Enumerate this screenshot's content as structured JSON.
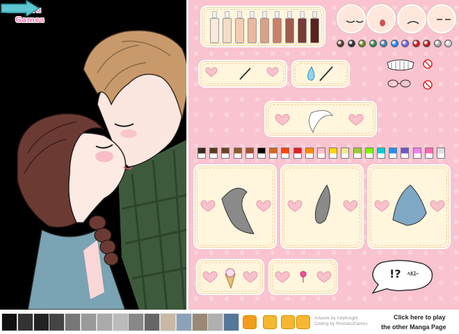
{
  "logo": {
    "line1": "Rinmaru",
    "line2": "Games"
  },
  "foundation_bottles": [
    {
      "color": "#fbe9dd"
    },
    {
      "color": "#f6dcc9"
    },
    {
      "color": "#f2cdb3"
    },
    {
      "color": "#eab99d"
    },
    {
      "color": "#dba183"
    },
    {
      "color": "#c9816a"
    },
    {
      "color": "#a05b4d"
    },
    {
      "color": "#7a3a34"
    },
    {
      "color": "#5a211e"
    }
  ],
  "eye_colors": [
    "#5b3a29",
    "#2c2c2c",
    "#6b8e23",
    "#2e8b57",
    "#4682b4",
    "#1e90ff",
    "#7b68ee",
    "#d11e1e",
    "#b22222",
    "#aaaaaa",
    "#cccccc"
  ],
  "hair_colors": [
    "#3a2a1c",
    "#5a3a1e",
    "#6b4226",
    "#8b5a2b",
    "#a0522d",
    "#000000",
    "#d2691e",
    "#ff4500",
    "#e02020",
    "#ff8c00",
    "#ffc0cb",
    "#ffd700",
    "#f0e68c",
    "#9acd32",
    "#7cfc00",
    "#00ced1",
    "#1e90ff",
    "#6a5acd",
    "#ee82ee",
    "#ff69b4",
    "#dddddd"
  ],
  "speech": {
    "text": "!?",
    "jp": "ﾍｷｽｰ"
  },
  "footer": {
    "credit_line1": "Artwork by milyKnight",
    "credit_line2": "Coding by RinmaruGames",
    "click_here": "Click here to play",
    "other_manga": "the other Manga Page"
  },
  "thumb_colors": [
    "#111",
    "#333",
    "#222",
    "#444",
    "#777",
    "#999",
    "#aaa",
    "#bbb",
    "#888",
    "#666",
    "#c9b9a3",
    "#8aa3b8",
    "#998877",
    "#b0b0b0",
    "#557799"
  ]
}
